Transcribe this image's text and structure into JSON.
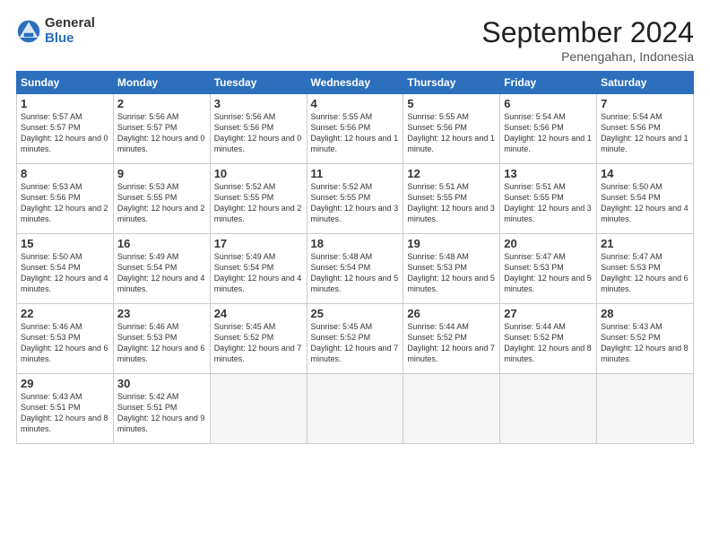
{
  "logo": {
    "general": "General",
    "blue": "Blue"
  },
  "header": {
    "month": "September 2024",
    "location": "Penengahan, Indonesia"
  },
  "weekdays": [
    "Sunday",
    "Monday",
    "Tuesday",
    "Wednesday",
    "Thursday",
    "Friday",
    "Saturday"
  ],
  "weeks": [
    [
      {
        "day": "1",
        "sunrise": "5:57 AM",
        "sunset": "5:57 PM",
        "daylight": "12 hours and 0 minutes."
      },
      {
        "day": "2",
        "sunrise": "5:56 AM",
        "sunset": "5:57 PM",
        "daylight": "12 hours and 0 minutes."
      },
      {
        "day": "3",
        "sunrise": "5:56 AM",
        "sunset": "5:56 PM",
        "daylight": "12 hours and 0 minutes."
      },
      {
        "day": "4",
        "sunrise": "5:55 AM",
        "sunset": "5:56 PM",
        "daylight": "12 hours and 1 minute."
      },
      {
        "day": "5",
        "sunrise": "5:55 AM",
        "sunset": "5:56 PM",
        "daylight": "12 hours and 1 minute."
      },
      {
        "day": "6",
        "sunrise": "5:54 AM",
        "sunset": "5:56 PM",
        "daylight": "12 hours and 1 minute."
      },
      {
        "day": "7",
        "sunrise": "5:54 AM",
        "sunset": "5:56 PM",
        "daylight": "12 hours and 1 minute."
      }
    ],
    [
      {
        "day": "8",
        "sunrise": "5:53 AM",
        "sunset": "5:56 PM",
        "daylight": "12 hours and 2 minutes."
      },
      {
        "day": "9",
        "sunrise": "5:53 AM",
        "sunset": "5:55 PM",
        "daylight": "12 hours and 2 minutes."
      },
      {
        "day": "10",
        "sunrise": "5:52 AM",
        "sunset": "5:55 PM",
        "daylight": "12 hours and 2 minutes."
      },
      {
        "day": "11",
        "sunrise": "5:52 AM",
        "sunset": "5:55 PM",
        "daylight": "12 hours and 3 minutes."
      },
      {
        "day": "12",
        "sunrise": "5:51 AM",
        "sunset": "5:55 PM",
        "daylight": "12 hours and 3 minutes."
      },
      {
        "day": "13",
        "sunrise": "5:51 AM",
        "sunset": "5:55 PM",
        "daylight": "12 hours and 3 minutes."
      },
      {
        "day": "14",
        "sunrise": "5:50 AM",
        "sunset": "5:54 PM",
        "daylight": "12 hours and 4 minutes."
      }
    ],
    [
      {
        "day": "15",
        "sunrise": "5:50 AM",
        "sunset": "5:54 PM",
        "daylight": "12 hours and 4 minutes."
      },
      {
        "day": "16",
        "sunrise": "5:49 AM",
        "sunset": "5:54 PM",
        "daylight": "12 hours and 4 minutes."
      },
      {
        "day": "17",
        "sunrise": "5:49 AM",
        "sunset": "5:54 PM",
        "daylight": "12 hours and 4 minutes."
      },
      {
        "day": "18",
        "sunrise": "5:48 AM",
        "sunset": "5:54 PM",
        "daylight": "12 hours and 5 minutes."
      },
      {
        "day": "19",
        "sunrise": "5:48 AM",
        "sunset": "5:53 PM",
        "daylight": "12 hours and 5 minutes."
      },
      {
        "day": "20",
        "sunrise": "5:47 AM",
        "sunset": "5:53 PM",
        "daylight": "12 hours and 5 minutes."
      },
      {
        "day": "21",
        "sunrise": "5:47 AM",
        "sunset": "5:53 PM",
        "daylight": "12 hours and 6 minutes."
      }
    ],
    [
      {
        "day": "22",
        "sunrise": "5:46 AM",
        "sunset": "5:53 PM",
        "daylight": "12 hours and 6 minutes."
      },
      {
        "day": "23",
        "sunrise": "5:46 AM",
        "sunset": "5:53 PM",
        "daylight": "12 hours and 6 minutes."
      },
      {
        "day": "24",
        "sunrise": "5:45 AM",
        "sunset": "5:52 PM",
        "daylight": "12 hours and 7 minutes."
      },
      {
        "day": "25",
        "sunrise": "5:45 AM",
        "sunset": "5:52 PM",
        "daylight": "12 hours and 7 minutes."
      },
      {
        "day": "26",
        "sunrise": "5:44 AM",
        "sunset": "5:52 PM",
        "daylight": "12 hours and 7 minutes."
      },
      {
        "day": "27",
        "sunrise": "5:44 AM",
        "sunset": "5:52 PM",
        "daylight": "12 hours and 8 minutes."
      },
      {
        "day": "28",
        "sunrise": "5:43 AM",
        "sunset": "5:52 PM",
        "daylight": "12 hours and 8 minutes."
      }
    ],
    [
      {
        "day": "29",
        "sunrise": "5:43 AM",
        "sunset": "5:51 PM",
        "daylight": "12 hours and 8 minutes."
      },
      {
        "day": "30",
        "sunrise": "5:42 AM",
        "sunset": "5:51 PM",
        "daylight": "12 hours and 9 minutes."
      },
      null,
      null,
      null,
      null,
      null
    ]
  ]
}
